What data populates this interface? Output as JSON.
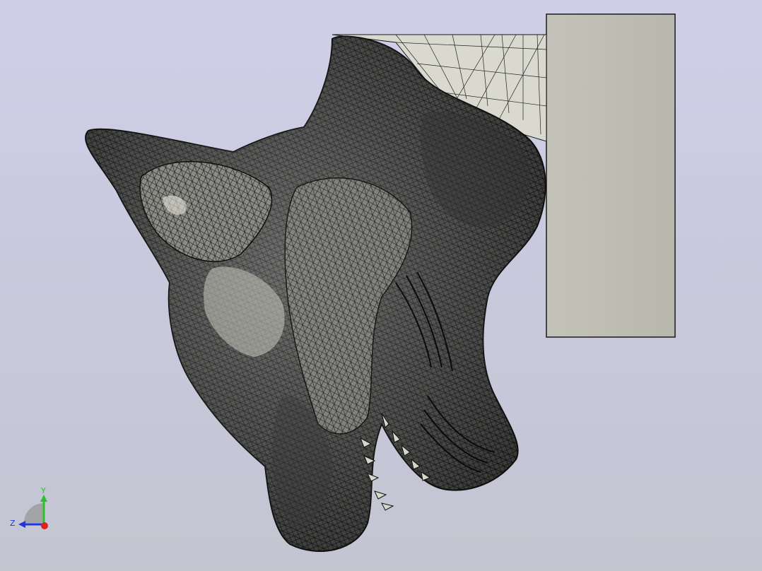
{
  "viewport": {
    "background_top": "#cfcfe8",
    "background_bottom": "#c3c5d1"
  },
  "model": {
    "name": "skull-mesh-model",
    "mesh_dark": "#2e2e2e",
    "mesh_light": "#d8d8cc",
    "wire": "#111111"
  },
  "block": {
    "fill": "#bdbcb2",
    "edge": "#1a1a1a"
  },
  "triad": {
    "y_label": "Y",
    "z_label": "Z",
    "y_color": "#2cc02c",
    "z_color": "#2233dd",
    "x_color": "#e02020"
  }
}
